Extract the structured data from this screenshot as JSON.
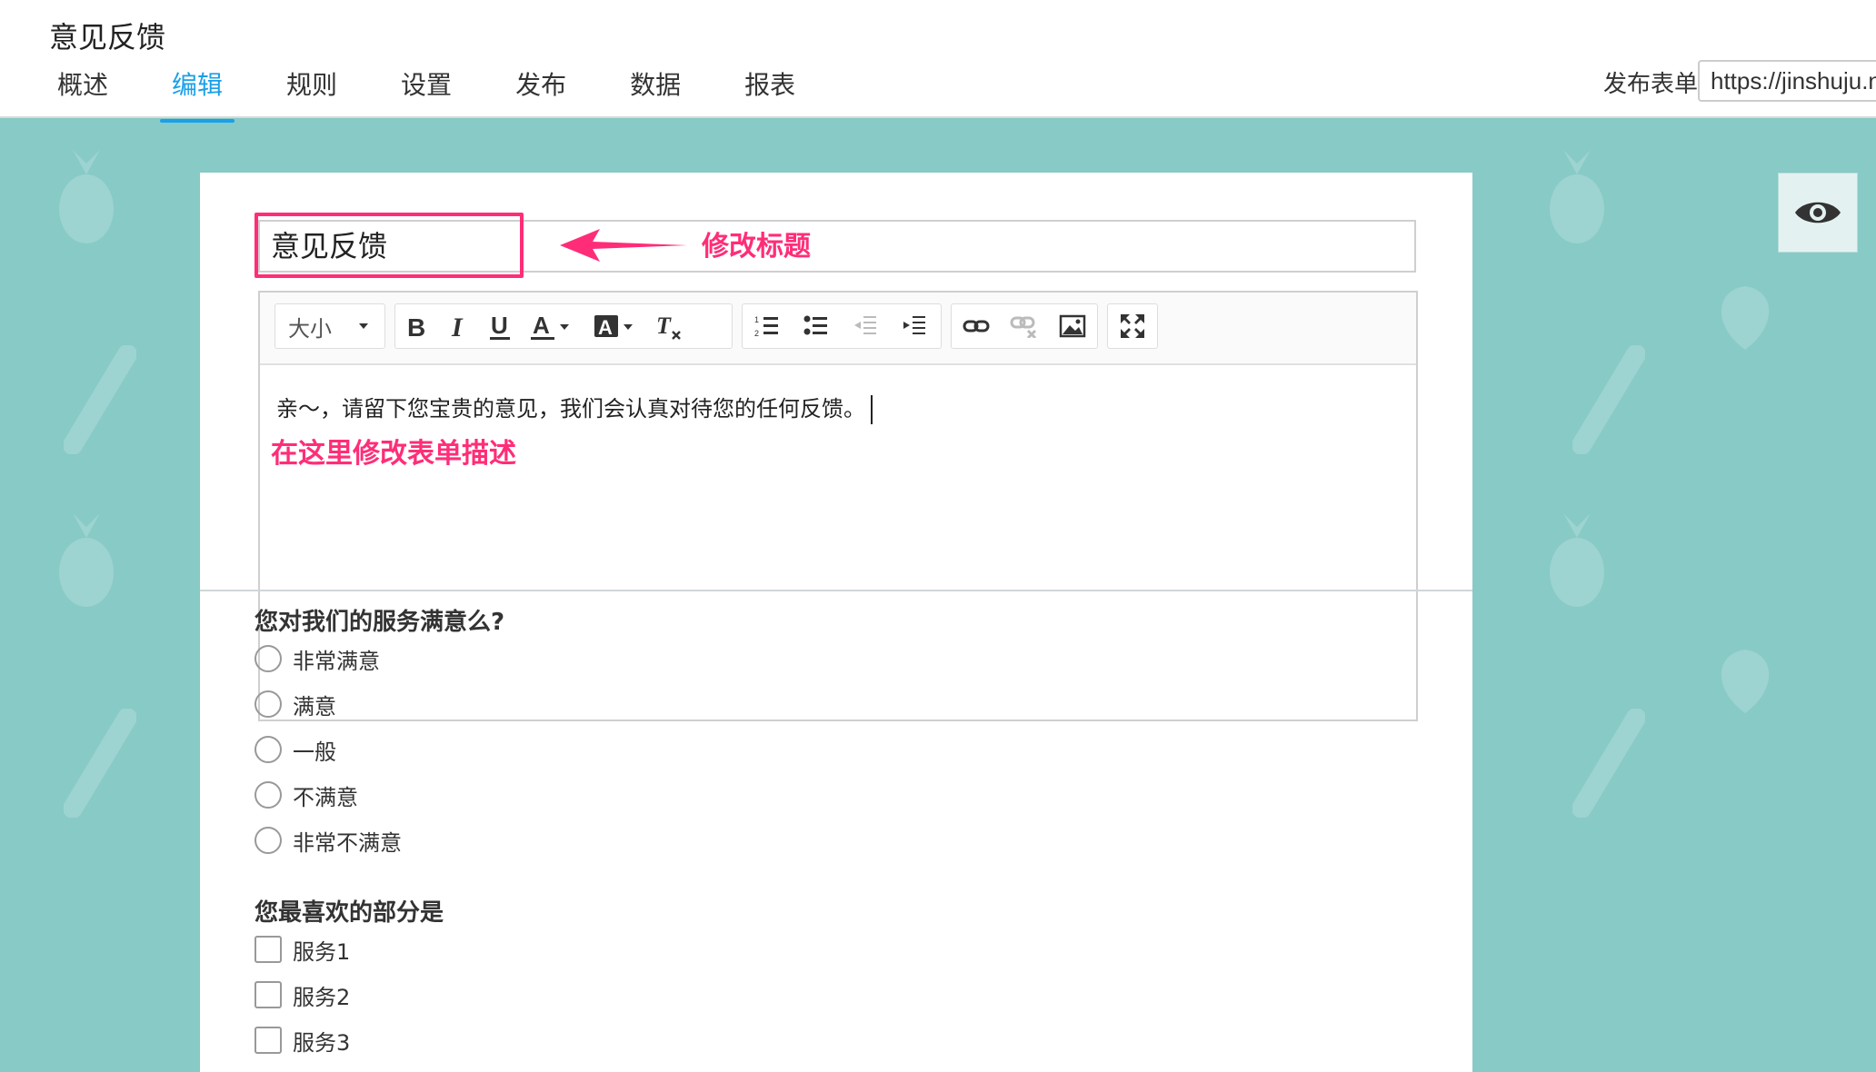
{
  "header": {
    "app_title": "意见反馈",
    "tabs": [
      {
        "label": "概述"
      },
      {
        "label": "编辑",
        "active": true
      },
      {
        "label": "规则"
      },
      {
        "label": "设置"
      },
      {
        "label": "发布"
      },
      {
        "label": "数据"
      },
      {
        "label": "报表"
      }
    ],
    "publish_label": "发布表单",
    "publish_url": "https://jinshuju.n"
  },
  "colors": {
    "accent": "#1aa0e8",
    "annotation": "#ff2d78",
    "background": "#87cac6"
  },
  "form": {
    "title": "意见反馈",
    "title_annotation": "修改标题",
    "description": "亲～，请留下您宝贵的意见，我们会认真对待您的任何反馈。",
    "description_annotation": "在这里修改表单描述",
    "toolbar": {
      "size_label": "大小",
      "icons": [
        "bold-icon",
        "italic-icon",
        "underline-icon",
        "font-color-icon",
        "background-color-icon",
        "clear-format-icon",
        "ordered-list-icon",
        "unordered-list-icon",
        "outdent-icon",
        "indent-icon",
        "link-icon",
        "unlink-icon",
        "image-icon",
        "fullscreen-icon"
      ]
    },
    "questions": [
      {
        "title": "您对我们的服务满意么?",
        "type": "radio",
        "options": [
          "非常满意",
          "满意",
          "一般",
          "不满意",
          "非常不满意"
        ]
      },
      {
        "title": "您最喜欢的部分是",
        "type": "checkbox",
        "options": [
          "服务1",
          "服务2",
          "服务3"
        ]
      }
    ]
  },
  "preview": {
    "icon": "eye-icon"
  }
}
